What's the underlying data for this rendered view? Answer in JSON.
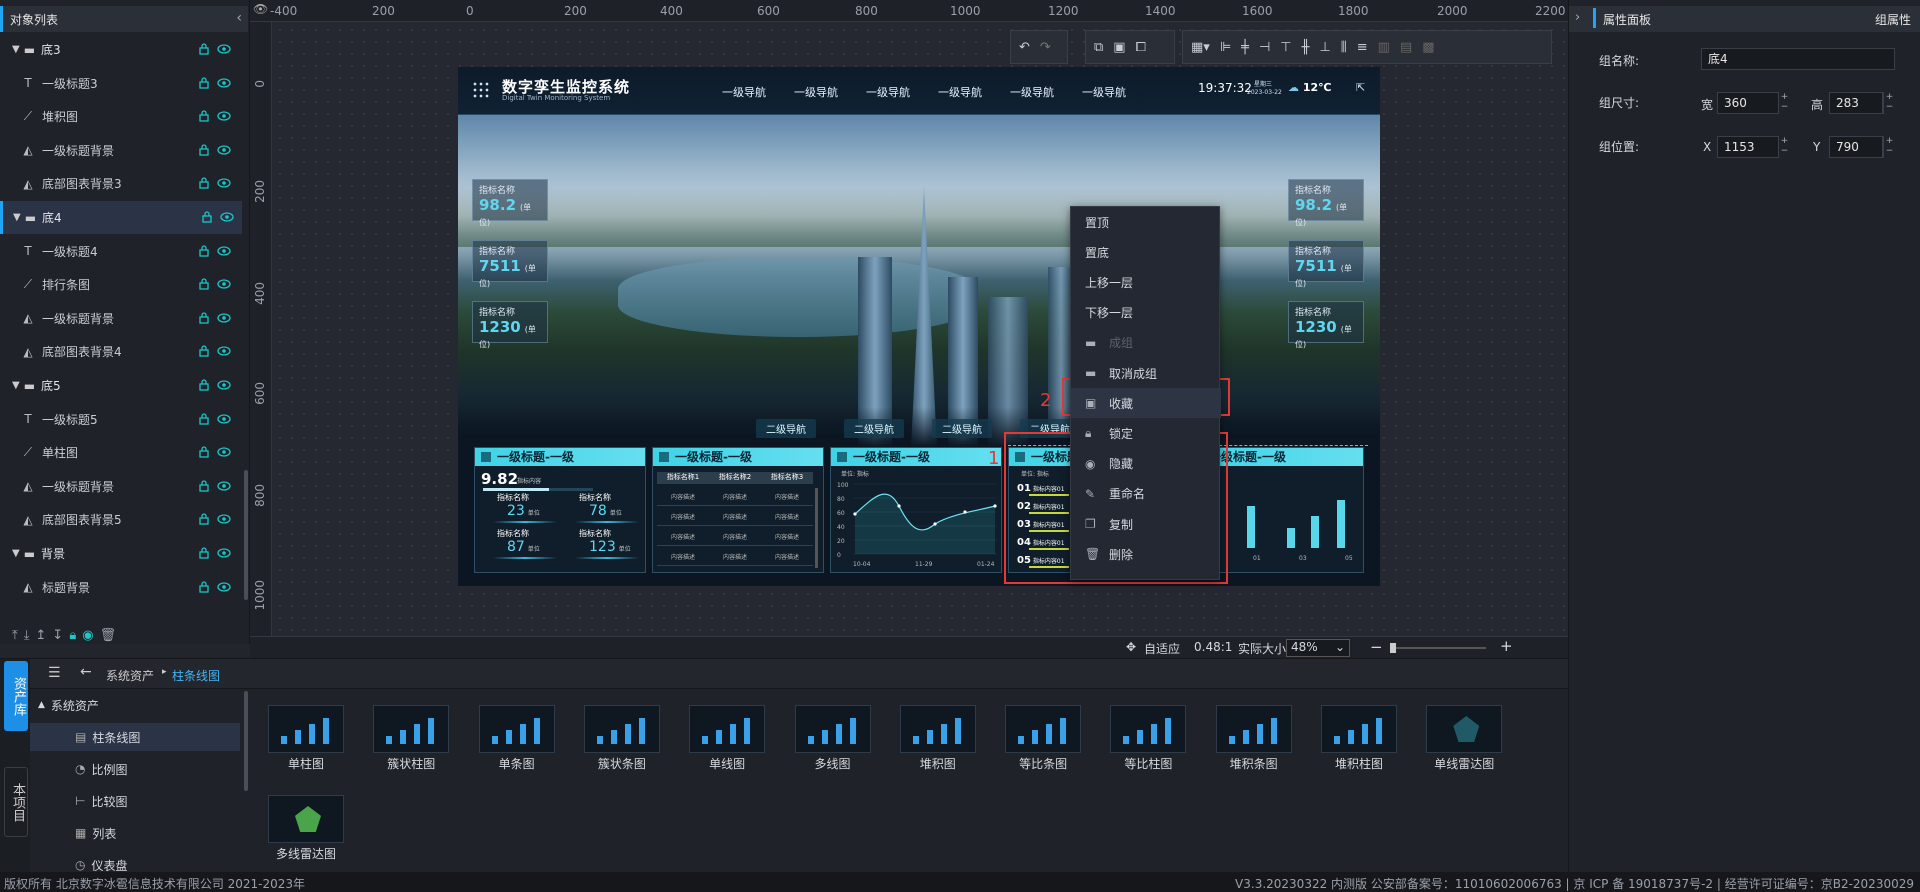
{
  "left_panel": {
    "title": "对象列表",
    "tree": [
      {
        "label": "底3",
        "kind": "group"
      },
      {
        "label": "一级标题3",
        "kind": "text"
      },
      {
        "label": "堆积图",
        "kind": "chart"
      },
      {
        "label": "一级标题背景",
        "kind": "shape"
      },
      {
        "label": "底部图表背景3",
        "kind": "shape"
      },
      {
        "label": "底4",
        "kind": "group",
        "selected": true
      },
      {
        "label": "一级标题4",
        "kind": "text"
      },
      {
        "label": "排行条图",
        "kind": "chart"
      },
      {
        "label": "一级标题背景",
        "kind": "shape"
      },
      {
        "label": "底部图表背景4",
        "kind": "shape"
      },
      {
        "label": "底5",
        "kind": "group"
      },
      {
        "label": "一级标题5",
        "kind": "text"
      },
      {
        "label": "单柱图",
        "kind": "chart"
      },
      {
        "label": "一级标题背景",
        "kind": "shape"
      },
      {
        "label": "底部图表背景5",
        "kind": "shape"
      },
      {
        "label": "背景",
        "kind": "group"
      },
      {
        "label": "标题背景",
        "kind": "shape"
      }
    ]
  },
  "rulers": {
    "top": [
      "-400",
      "200",
      "0",
      "200",
      "400",
      "600",
      "800",
      "1000",
      "1200",
      "1400",
      "1600",
      "1800",
      "2000",
      "2200"
    ],
    "left": [
      "0",
      "200",
      "400",
      "600",
      "800",
      "1000"
    ]
  },
  "screen": {
    "title": "数字孪生监控系统",
    "subtitle": "Digital Twin Monitoring System",
    "nav": [
      "一级导航",
      "一级导航",
      "一级导航",
      "一级导航",
      "一级导航",
      "一级导航"
    ],
    "time": "19:37:32",
    "weekday": "星期三",
    "date": "2023-03-22",
    "temp": "12℃",
    "kpi_left": [
      {
        "name": "指标名称",
        "value": "98.2",
        "unit": "(单位)"
      },
      {
        "name": "指标名称",
        "value": "7511",
        "unit": "(单位)"
      },
      {
        "name": "指标名称",
        "value": "1230",
        "unit": "(单位)"
      }
    ],
    "kpi_right": [
      {
        "name": "指标名称",
        "value": "98.2",
        "unit": "(单位)"
      },
      {
        "name": "指标名称",
        "value": "7511",
        "unit": "(单位)"
      },
      {
        "name": "指标名称",
        "value": "1230",
        "unit": "(单位)"
      }
    ],
    "subnav": [
      "二级导航",
      "二级导航",
      "二级导航",
      "二级导航"
    ],
    "card_title": "一级标题-一级",
    "card1": {
      "big": "9.82",
      "big_label": "指标内容",
      "items": [
        {
          "n": "指标名称",
          "v": "23"
        },
        {
          "n": "指标名称",
          "v": "78"
        },
        {
          "n": "指标名称",
          "v": "87"
        },
        {
          "n": "指标名称",
          "v": "123"
        }
      ],
      "unit": "单位"
    },
    "card2": {
      "headers": [
        "指标名称1",
        "指标名称2",
        "指标名称3"
      ],
      "cell": "内容描述"
    },
    "card3": {
      "unit_label": "单位: 指标",
      "yticks": [
        "100",
        "80",
        "60",
        "40",
        "20",
        "0"
      ],
      "xticks": [
        "10-04",
        "11-29",
        "01-24"
      ]
    },
    "card4": {
      "unit_label": "单位: 指标",
      "ranks": [
        "01",
        "02",
        "03",
        "04",
        "05"
      ],
      "rank_text": "指标内容01"
    },
    "card5": {
      "xticks": [
        "01",
        "03",
        "05"
      ]
    }
  },
  "context_menu": {
    "items": [
      {
        "label": "置顶",
        "icon": "",
        "disabled": false
      },
      {
        "label": "置底",
        "icon": "",
        "disabled": false
      },
      {
        "label": "上移一层",
        "icon": "",
        "disabled": false
      },
      {
        "label": "下移一层",
        "icon": "",
        "disabled": false
      },
      {
        "label": "成组",
        "icon": "folder-icon",
        "disabled": true
      },
      {
        "label": "取消成组",
        "icon": "folder-icon",
        "disabled": false
      },
      {
        "label": "收藏",
        "icon": "favorite-folder-icon",
        "disabled": false
      },
      {
        "label": "锁定",
        "icon": "lock-icon",
        "disabled": false
      },
      {
        "label": "隐藏",
        "icon": "eye-icon",
        "disabled": false
      },
      {
        "label": "重命名",
        "icon": "pencil-icon",
        "disabled": false
      },
      {
        "label": "复制",
        "icon": "copy-icon",
        "disabled": false
      },
      {
        "label": "删除",
        "icon": "trash-icon",
        "disabled": false
      }
    ],
    "annotation_1": "1",
    "annotation_2": "2"
  },
  "zoom_bar": {
    "fit": "自适应",
    "ratio": "0.48:1",
    "actual": "实际大小",
    "zoom": "48%"
  },
  "right_panel": {
    "title": "属性面板",
    "mode": "组属性",
    "name_label": "组名称:",
    "name_value": "底4",
    "size_label": "组尺寸:",
    "width_label": "宽",
    "width_value": "360",
    "height_label": "高",
    "height_value": "283",
    "pos_label": "组位置:",
    "x_label": "X",
    "x_value": "1153",
    "y_label": "Y",
    "y_value": "790"
  },
  "assets": {
    "tab_library": "资产库",
    "tab_project": "本项目",
    "breadcrumb_root": "系统资产",
    "breadcrumb_current": "柱条线图",
    "tree_root": "系统资产",
    "categories": [
      "柱条线图",
      "比例图",
      "比较图",
      "列表",
      "仪表盘"
    ],
    "items": [
      "单柱图",
      "簇状柱图",
      "单条图",
      "簇状条图",
      "单线图",
      "多线图",
      "堆积图",
      "等比条图",
      "等比柱图",
      "堆积条图",
      "堆积柱图",
      "单线雷达图",
      "多线雷达图"
    ]
  },
  "footer": {
    "left": "版权所有 北京数字冰雹信息技术有限公司 2021-2023年",
    "right": "V3.3.20230322 内测版 公安部备案号：11010602006763 | 京 ICP 备 19018737号-2 | 经营许可证编号：京B2-20230029"
  },
  "colors": {
    "accent": "#1ea6f5",
    "highlight": "#e53935",
    "cyan": "#3fd3e6"
  }
}
